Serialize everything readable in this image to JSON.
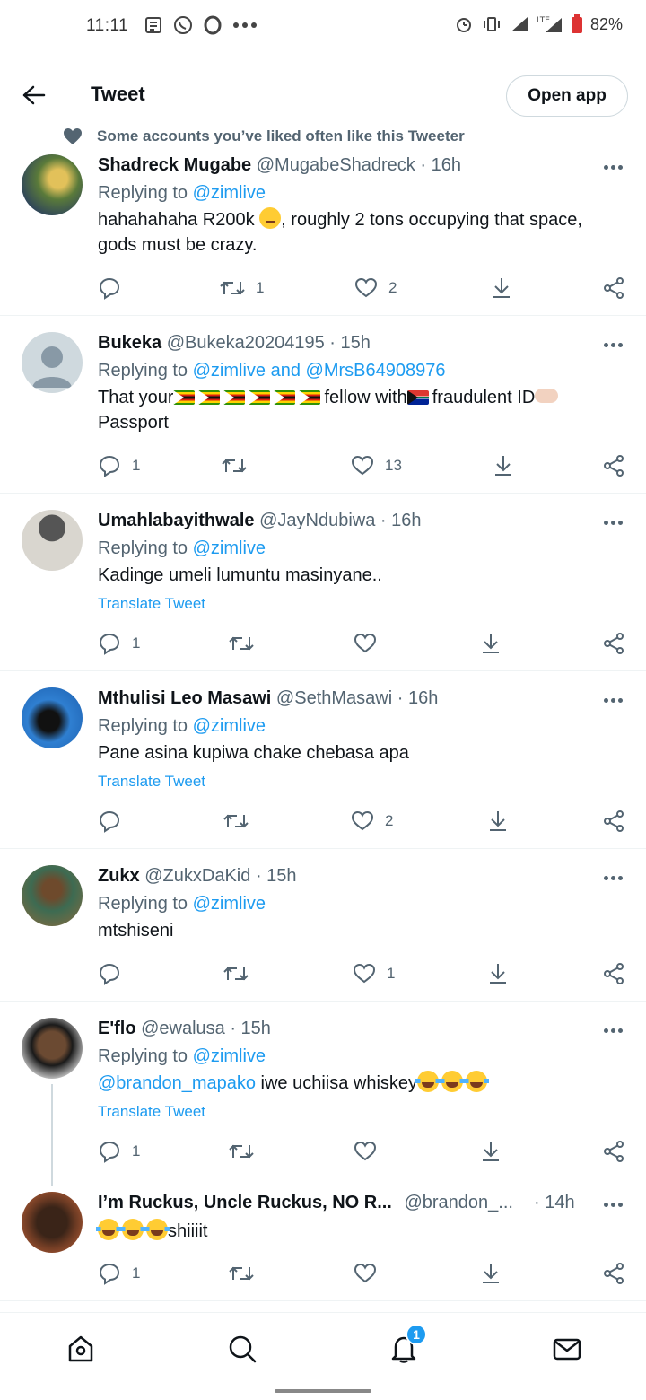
{
  "status_bar": {
    "time": "11:11",
    "battery": "82%"
  },
  "header": {
    "title": "Tweet",
    "open_app": "Open app"
  },
  "social_context": "Some accounts you’ve liked often like this Tweeter",
  "tweets": [
    {
      "name": "Shadreck Mugabe",
      "handle": "@MugabeShadreck",
      "time": "· 16h",
      "replying_prefix": "Replying to",
      "replying_to": "@zimlive",
      "text_a": "hahahahaha R200k",
      "text_b": ", roughly 2 tons occupying that space, gods must be crazy.",
      "emoji_icon": "thinking-face-emoji",
      "replies": "",
      "retweets": "1",
      "likes": "2"
    },
    {
      "name": "Bukeka",
      "handle": "@Bukeka20204195",
      "time": "· 15h",
      "replying_prefix": "Replying to",
      "replying_to": "@zimlive and @MrsB64908976",
      "text_a": "That your",
      "text_b": "fellow with",
      "text_c": "fraudulent ID",
      "text_d": "Passport",
      "flag_icons": [
        "zimbabwe-flag",
        "south-africa-flag"
      ],
      "replies": "1",
      "retweets": "",
      "likes": "13"
    },
    {
      "name": "Umahlabayithwale",
      "handle": "@JayNdubiwa",
      "time": "· 16h",
      "replying_prefix": "Replying to",
      "replying_to": "@zimlive",
      "text": "Kadinge umeli lumuntu masinyane..",
      "translate": "Translate Tweet",
      "replies": "1",
      "retweets": "",
      "likes": ""
    },
    {
      "name": "Mthulisi Leo Masawi",
      "handle": "@SethMasawi",
      "time": "· 16h",
      "replying_prefix": "Replying to",
      "replying_to": "@zimlive",
      "text": "Pane asina kupiwa chake chebasa apa",
      "translate": "Translate Tweet",
      "replies": "",
      "retweets": "",
      "likes": "2"
    },
    {
      "name": "Zukx",
      "handle": "@ZukxDaKid",
      "time": "· 15h",
      "replying_prefix": "Replying to",
      "replying_to": "@zimlive",
      "text": "mtshiseni",
      "replies": "",
      "retweets": "",
      "likes": "1"
    },
    {
      "name": "E'flo",
      "handle": "@ewalusa",
      "time": "· 15h",
      "replying_prefix": "Replying to",
      "replying_to": "@zimlive",
      "mention": "@brandon_mapako",
      "text": "iwe uchiisa whiskey",
      "translate": "Translate Tweet",
      "emoji_icon": "tears-of-joy-emoji",
      "replies": "1",
      "retweets": "",
      "likes": ""
    },
    {
      "name": "I’m Ruckus, Uncle Ruckus, NO R...",
      "handle": "@brandon_...",
      "time": "· 14h",
      "text": "shiiiit",
      "emoji_icon": "tears-of-joy-emoji",
      "replies": "1",
      "retweets": "",
      "likes": ""
    }
  ],
  "bottom_nav": {
    "notifications_badge": "1"
  },
  "colors": {
    "accent": "#1d9bf0",
    "secondary_text": "#536471",
    "divider": "#eff3f4"
  }
}
